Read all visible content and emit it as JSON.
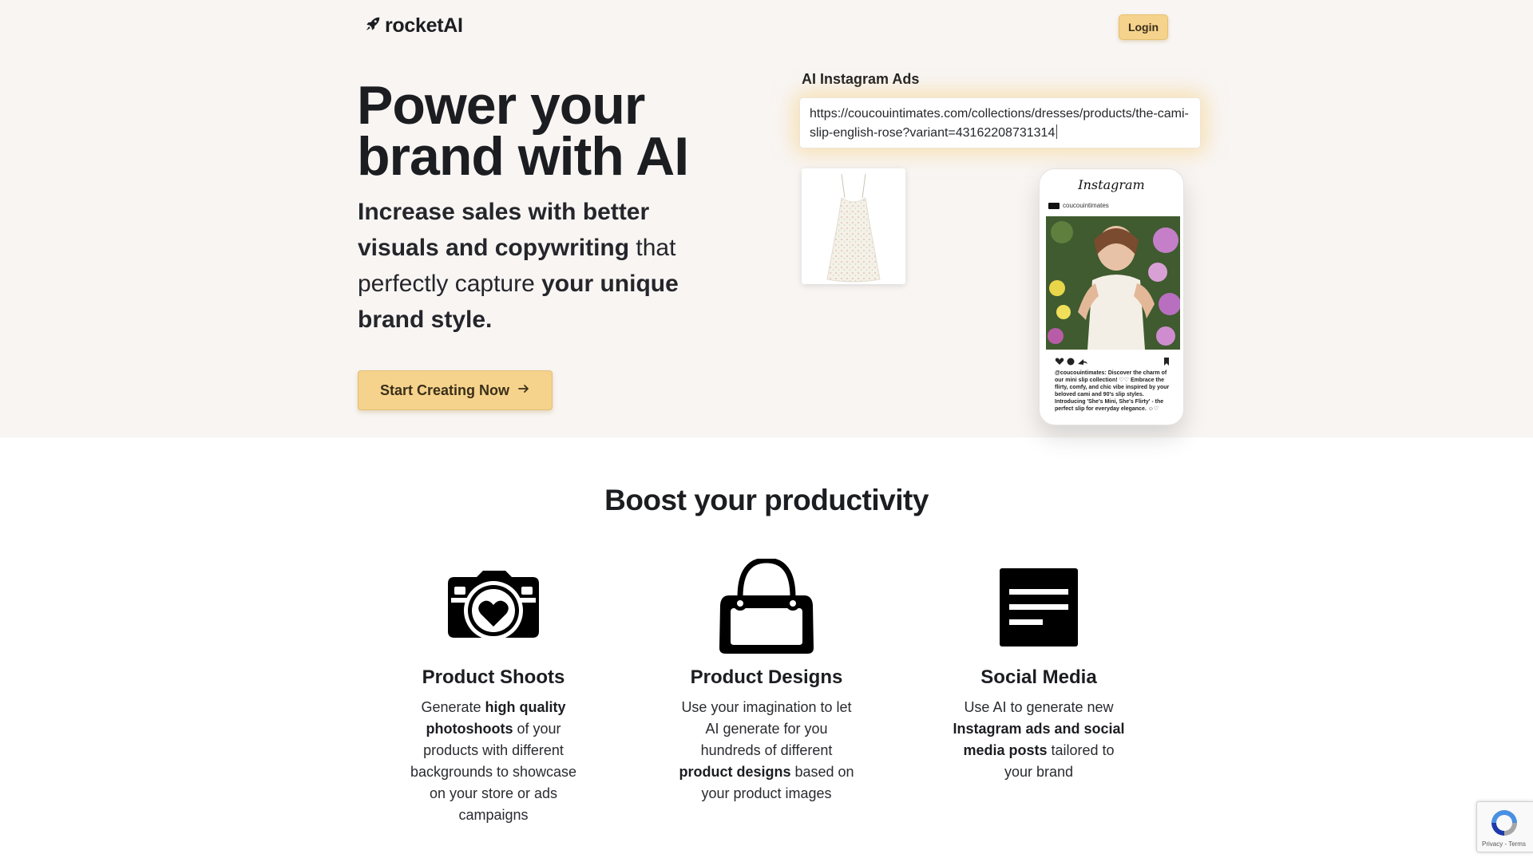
{
  "header": {
    "logo_text": "rocketAI",
    "login_label": "Login"
  },
  "hero": {
    "title": "Power your brand with AI",
    "subtitle_parts": [
      {
        "text": "Increase sales with better visuals and copywriting",
        "bold": true
      },
      {
        "text": " that perfectly capture ",
        "bold": false
      },
      {
        "text": "your unique brand style.",
        "bold": true
      }
    ],
    "cta_label": "Start Creating Now"
  },
  "demo": {
    "label": "AI Instagram Ads",
    "url_value": "https://coucouintimates.com/collections/dresses/products/the-cami-slip-english-rose?variant=43162208731314",
    "instagram": {
      "logo_text": "Instagram",
      "username": "coucouintimates",
      "caption": "@coucouintimates: Discover the charm of our mini slip collection! ♡♡ Embrace the flirty, comfy, and chic vibe inspired by your beloved cami and 90's slip styles. Introducing 'She's Mini, She's Flirty' - the perfect slip for everyday elegance. ☺♡"
    }
  },
  "features": {
    "section_title": "Boost your productivity",
    "items": [
      {
        "icon": "camera-heart-icon",
        "title": "Product Shoots",
        "parts": [
          {
            "text": "Generate ",
            "bold": false
          },
          {
            "text": "high quality photoshoots",
            "bold": true
          },
          {
            "text": " of your products with different backgrounds to showcase on your store or ads campaigns",
            "bold": false
          }
        ]
      },
      {
        "icon": "handbag-icon",
        "title": "Product Designs",
        "parts": [
          {
            "text": "Use your imagination to let AI generate for you hundreds of different ",
            "bold": false
          },
          {
            "text": "product designs",
            "bold": true
          },
          {
            "text": " based on your product images",
            "bold": false
          }
        ]
      },
      {
        "icon": "article-icon",
        "title": "Social Media",
        "parts": [
          {
            "text": "Use AI to generate new ",
            "bold": false
          },
          {
            "text": "Instagram ads and social media posts",
            "bold": true
          },
          {
            "text": " tailored to your brand",
            "bold": false
          }
        ]
      }
    ]
  },
  "recaptcha": {
    "terms_text": "Privacy - Terms"
  },
  "colors": {
    "accent": "#f5d38c",
    "hero_background": "#f8f5f3",
    "text": "#1c1d21"
  }
}
